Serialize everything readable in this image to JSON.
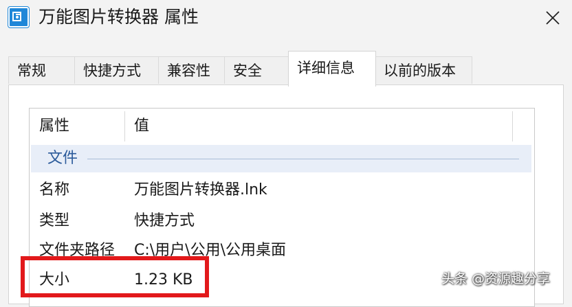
{
  "window": {
    "title": "万能图片转换器 属性",
    "icon": "app-icon",
    "close_icon": "close-icon"
  },
  "tabs": [
    {
      "label": "常规",
      "active": false
    },
    {
      "label": "快捷方式",
      "active": false
    },
    {
      "label": "兼容性",
      "active": false
    },
    {
      "label": "安全",
      "active": false
    },
    {
      "label": "详细信息",
      "active": true
    },
    {
      "label": "以前的版本",
      "active": false
    }
  ],
  "details": {
    "columns": [
      "属性",
      "值"
    ],
    "group": "文件",
    "rows": [
      {
        "key": "名称",
        "value": "万能图片转换器.lnk"
      },
      {
        "key": "类型",
        "value": "快捷方式"
      },
      {
        "key": "文件夹路径",
        "value": "C:\\用户\\公用\\公用桌面"
      },
      {
        "key": "大小",
        "value": "1.23 KB"
      }
    ]
  },
  "watermark": "头条 @资源趣分享",
  "colors": {
    "highlight": "#e2191b",
    "group_bg": "#e8eef8",
    "accent": "#1f87d8"
  }
}
